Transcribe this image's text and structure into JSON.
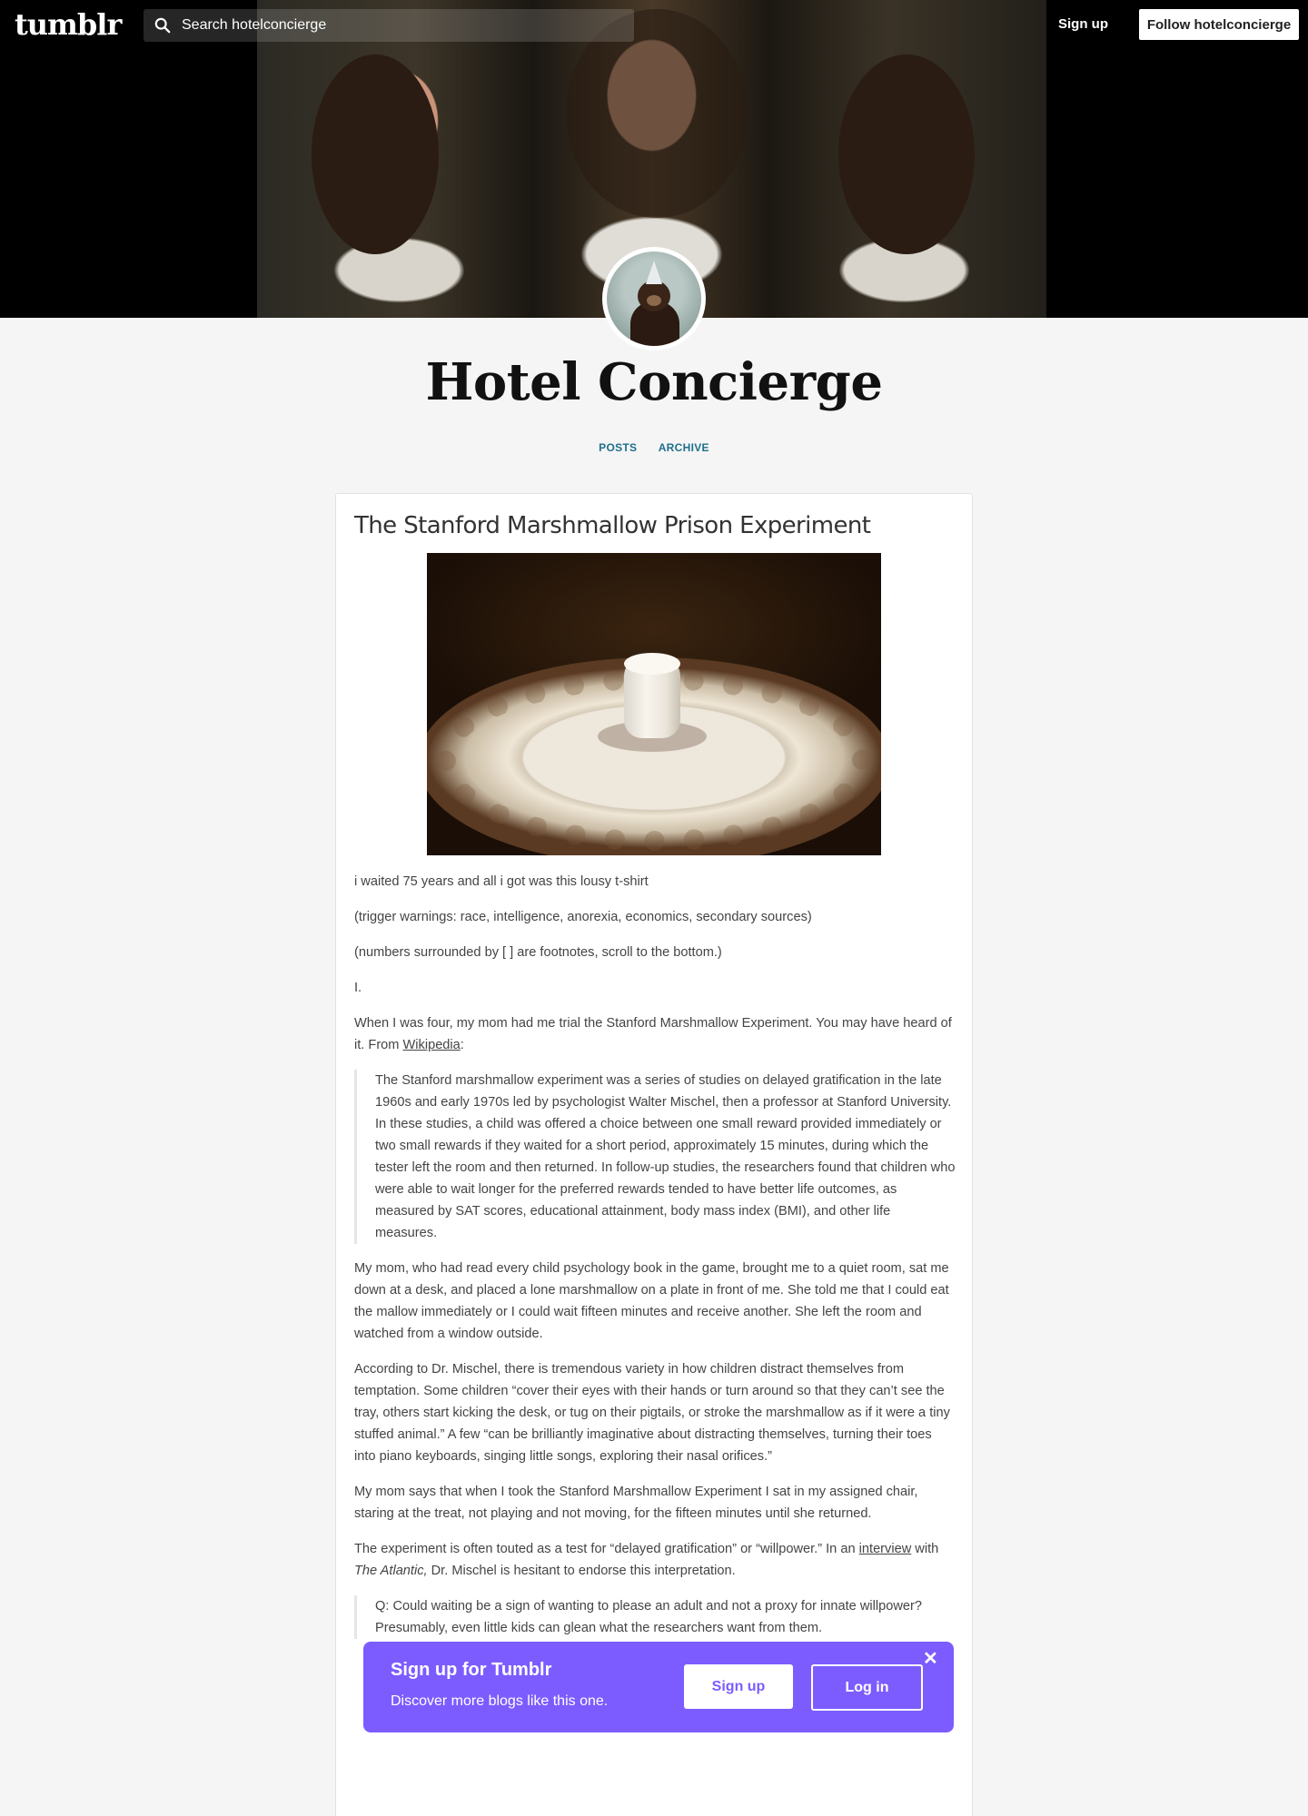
{
  "topbar": {
    "logo": "tumblr",
    "search_placeholder": "Search hotelconcierge",
    "signup": "Sign up",
    "follow": "Follow hotelconcierge"
  },
  "blog": {
    "title": "Hotel Concierge",
    "nav": [
      "POSTS",
      "ARCHIVE"
    ]
  },
  "post": {
    "title": "The Stanford Marshmallow Prison Experiment",
    "p1": "i waited 75 years and all i got was this lousy t-shirt",
    "p2": "(trigger warnings: race, intelligence, anorexia, economics, secondary sources)",
    "p3": "(numbers surrounded by [ ] are footnotes, scroll to the bottom.)",
    "p4": "I.",
    "p5_a": "When I was four, my mom had me trial the Stanford Marshmallow Experiment. You may have heard of it. From ",
    "p5_link": "Wikipedia",
    "p5_b": ":",
    "quote1": "The Stanford marshmallow experiment was a series of studies on delayed gratification in the late 1960s and early 1970s led by psychologist Walter Mischel, then a professor at Stanford University. In these studies, a child was offered a choice between one small reward provided immediately or two small rewards if they waited for a short period, approximately 15 minutes, during which the tester left the room and then returned. In follow-up studies, the researchers found that children who were able to wait longer for the preferred rewards tended to have better life outcomes, as measured by SAT scores, educational attainment, body mass index (BMI), and other life measures.",
    "p6": "My mom, who had read every child psychology book in the game, brought me to a quiet room, sat me down at a desk, and placed a lone marshmallow on a plate in front of me. She told me that I could eat the mallow immediately or I could wait fifteen minutes and receive another. She left the room and watched from a window outside.",
    "p7": "According to Dr. Mischel, there is tremendous variety in how children distract themselves from temptation. Some children “cover their eyes with their hands or turn around so that they can’t see the tray, others start kicking the desk, or tug on their pigtails, or stroke the marshmallow as if it were a tiny stuffed animal.” A few “can be brilliantly imaginative about distracting themselves, turning their toes into piano keyboards, singing little songs, exploring their nasal orifices.”",
    "p8": "My mom says that when I took the Stanford Marshmallow Experiment I sat in my assigned chair, staring at the treat, not playing and not moving, for the fifteen minutes until she returned.",
    "p9_a": "The experiment is often touted as a test for “delayed gratification” or “willpower.” In an ",
    "p9_link": "interview",
    "p9_b": " with ",
    "p9_em": "The Atlantic,",
    "p9_c": " Dr. Mischel is hesitant to endorse this interpretation.",
    "quote2": "Q: Could waiting be a sign of wanting to please an adult and not a proxy for innate willpower? Presumably, even little kids can glean what the researchers want from them."
  },
  "popup": {
    "title": "Sign up for Tumblr",
    "subtitle": "Discover more blogs like this one.",
    "signup": "Sign up",
    "login": "Log in",
    "close": "✕"
  }
}
